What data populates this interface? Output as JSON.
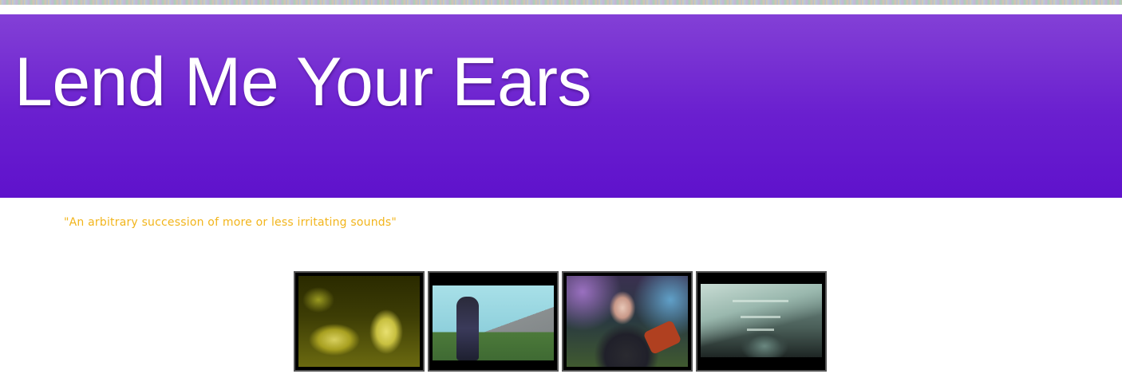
{
  "header": {
    "title": "Lend Me Your Ears",
    "background_colors": [
      "#8340d6",
      "#5f12cc"
    ]
  },
  "tagline": {
    "text": "\"An arbitrary succession of more or less irritating sounds\"",
    "color": "#f2b51c"
  },
  "thumbnails": [
    {
      "icon": "video-thumbnail-1"
    },
    {
      "icon": "video-thumbnail-2"
    },
    {
      "icon": "video-thumbnail-3"
    },
    {
      "icon": "video-thumbnail-4"
    }
  ]
}
